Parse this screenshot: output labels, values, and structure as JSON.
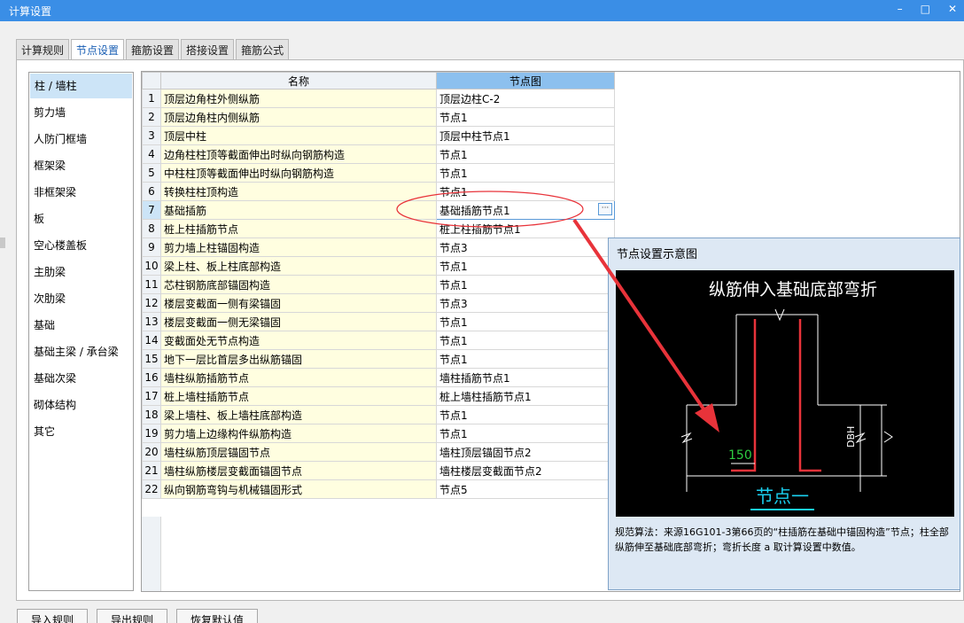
{
  "window": {
    "title": "计算设置",
    "minimize": "–",
    "maximize": "□",
    "close": "✕"
  },
  "tabs": [
    {
      "label": "计算规则"
    },
    {
      "label": "节点设置"
    },
    {
      "label": "箍筋设置"
    },
    {
      "label": "搭接设置"
    },
    {
      "label": "箍筋公式"
    }
  ],
  "active_tab": 1,
  "sidebar": {
    "items": [
      "柱 / 墙柱",
      "剪力墙",
      "人防门框墙",
      "框架梁",
      "非框架梁",
      "板",
      "空心楼盖板",
      "主肋梁",
      "次肋梁",
      "基础",
      "基础主梁 / 承台梁",
      "基础次梁",
      "砌体结构",
      "其它"
    ]
  },
  "table": {
    "headers": {
      "name": "名称",
      "node": "节点图"
    },
    "rows": [
      {
        "num": "1",
        "name": "顶层边角柱外侧纵筋",
        "node": "顶层边柱C-2"
      },
      {
        "num": "2",
        "name": "顶层边角柱内侧纵筋",
        "node": "节点1"
      },
      {
        "num": "3",
        "name": "顶层中柱",
        "node": "顶层中柱节点1"
      },
      {
        "num": "4",
        "name": "边角柱柱顶等截面伸出时纵向钢筋构造",
        "node": "节点1"
      },
      {
        "num": "5",
        "name": "中柱柱顶等截面伸出时纵向钢筋构造",
        "node": "节点1"
      },
      {
        "num": "6",
        "name": "转换柱柱顶构造",
        "node": "节点1"
      },
      {
        "num": "7",
        "name": "基础插筋",
        "node": "基础插筋节点1"
      },
      {
        "num": "8",
        "name": "桩上柱插筋节点",
        "node": "桩上柱插筋节点1"
      },
      {
        "num": "9",
        "name": "剪力墙上柱锚固构造",
        "node": "节点3"
      },
      {
        "num": "10",
        "name": "梁上柱、板上柱底部构造",
        "node": "节点1"
      },
      {
        "num": "11",
        "name": "芯柱钢筋底部锚固构造",
        "node": "节点1"
      },
      {
        "num": "12",
        "name": "楼层变截面一侧有梁锚固",
        "node": "节点3"
      },
      {
        "num": "13",
        "name": "楼层变截面一侧无梁锚固",
        "node": "节点1"
      },
      {
        "num": "14",
        "name": "变截面处无节点构造",
        "node": "节点1"
      },
      {
        "num": "15",
        "name": "地下一层比首层多出纵筋锚固",
        "node": "节点1"
      },
      {
        "num": "16",
        "name": "墙柱纵筋插筋节点",
        "node": "墙柱插筋节点1"
      },
      {
        "num": "17",
        "name": "桩上墙柱插筋节点",
        "node": "桩上墙柱插筋节点1"
      },
      {
        "num": "18",
        "name": "梁上墙柱、板上墙柱底部构造",
        "node": "节点1"
      },
      {
        "num": "19",
        "name": "剪力墙上边缘构件纵筋构造",
        "node": "节点1"
      },
      {
        "num": "20",
        "name": "墙柱纵筋顶层锚固节点",
        "node": "墙柱顶层锚固节点2"
      },
      {
        "num": "21",
        "name": "墙柱纵筋楼层变截面锚固节点",
        "node": "墙柱楼层变截面节点2"
      },
      {
        "num": "22",
        "name": "纵向钢筋弯钩与机械锚固形式",
        "node": "节点5"
      }
    ],
    "selected_row": 7,
    "ellipsis": "···"
  },
  "preview": {
    "title": "节点设置示意图",
    "drawing_title": "纵筋伸入基础底部弯折",
    "dim_label": "150",
    "dim_label_side": "DBH",
    "caption": "节点一",
    "description": "规范算法：来源16G101-3第66页的“柱插筋在基础中锚固构造”节点；柱全部纵筋伸至基础底部弯折；弯折长度 a 取计算设置中数值。"
  },
  "buttons": {
    "import": "导入规则",
    "export": "导出规则",
    "restore": "恢复默认值"
  },
  "colors": {
    "titlebar": "#3a8ee6",
    "annotation": "#e8333a",
    "header_selected": "#8cc0ee",
    "name_cell": "#fffee0"
  }
}
